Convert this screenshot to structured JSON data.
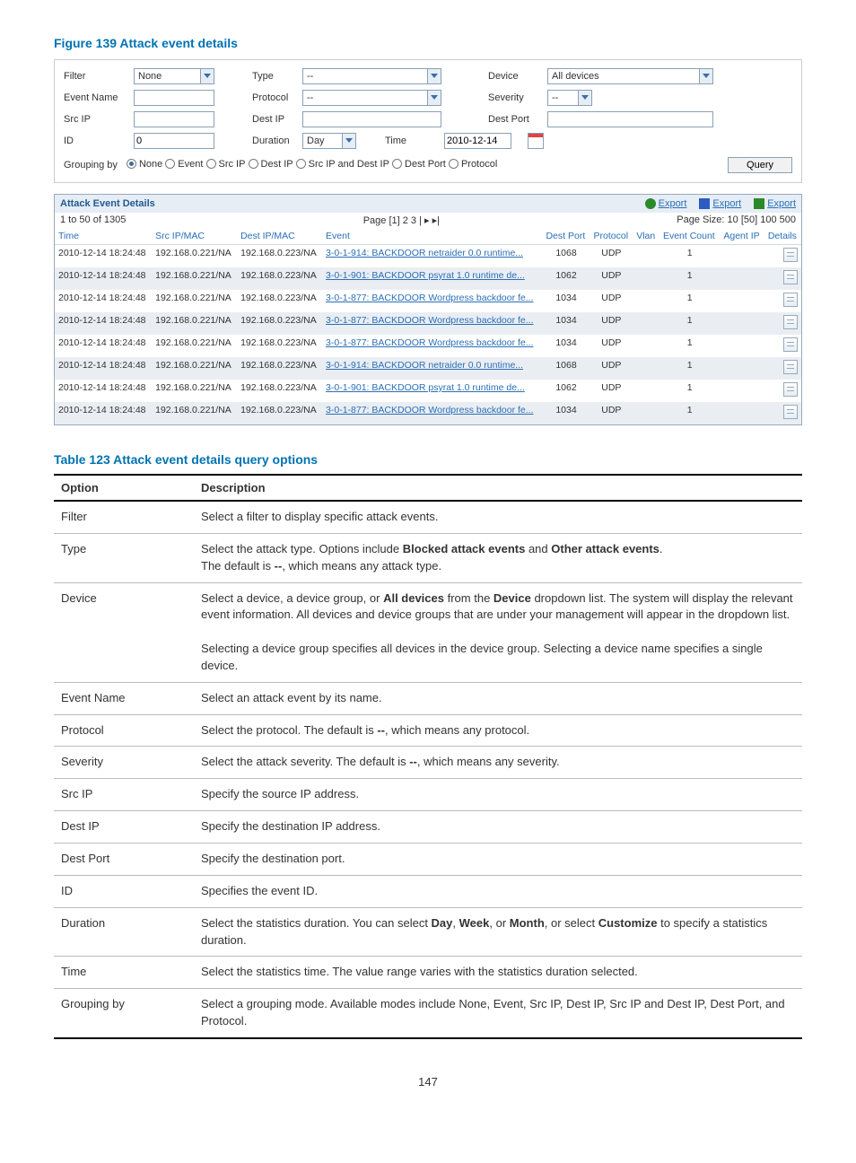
{
  "figure_title": "Figure 139 Attack event details",
  "filter": {
    "labels": {
      "filter": "Filter",
      "type": "Type",
      "device": "Device",
      "event_name": "Event Name",
      "protocol": "Protocol",
      "severity": "Severity",
      "src_ip": "Src IP",
      "dest_ip": "Dest IP",
      "dest_port": "Dest Port",
      "id": "ID",
      "duration": "Duration",
      "time": "Time"
    },
    "values": {
      "filter": "None",
      "type": "--",
      "device": "All devices",
      "event_name": "",
      "protocol": "--",
      "severity": "--",
      "src_ip": "",
      "dest_ip": "",
      "dest_port": "",
      "id": "0",
      "duration": "Day",
      "time": "2010-12-14"
    },
    "grouping_label": "Grouping by",
    "grouping_options": [
      "None",
      "Event",
      "Src IP",
      "Dest IP",
      "Src IP and Dest IP",
      "Dest Port",
      "Protocol"
    ],
    "grouping_selected": "None",
    "query_button": "Query"
  },
  "details": {
    "title": "Attack Event Details",
    "exports": [
      "Export",
      "Export",
      "Export"
    ],
    "count_text": "1 to 50 of 1305",
    "pager": "Page [1] 2 3 | ▸ ▸|",
    "page_size": "Page Size: 10 [50] 100 500",
    "columns": [
      "Time",
      "Src IP/MAC",
      "Dest IP/MAC",
      "Event",
      "Dest Port",
      "Protocol",
      "Vlan",
      "Event Count",
      "Agent IP",
      "Details"
    ],
    "rows": [
      {
        "time": "2010-12-14 18:24:48",
        "src": "192.168.0.221/NA",
        "dst": "192.168.0.223/NA",
        "event": "3-0-1-914: BACKDOOR netraider 0.0 runtime...",
        "port": "1068",
        "proto": "UDP",
        "count": "1"
      },
      {
        "time": "2010-12-14 18:24:48",
        "src": "192.168.0.221/NA",
        "dst": "192.168.0.223/NA",
        "event": "3-0-1-901: BACKDOOR psyrat 1.0 runtime de...",
        "port": "1062",
        "proto": "UDP",
        "count": "1"
      },
      {
        "time": "2010-12-14 18:24:48",
        "src": "192.168.0.221/NA",
        "dst": "192.168.0.223/NA",
        "event": "3-0-1-877: BACKDOOR Wordpress backdoor fe...",
        "port": "1034",
        "proto": "UDP",
        "count": "1"
      },
      {
        "time": "2010-12-14 18:24:48",
        "src": "192.168.0.221/NA",
        "dst": "192.168.0.223/NA",
        "event": "3-0-1-877: BACKDOOR Wordpress backdoor fe...",
        "port": "1034",
        "proto": "UDP",
        "count": "1"
      },
      {
        "time": "2010-12-14 18:24:48",
        "src": "192.168.0.221/NA",
        "dst": "192.168.0.223/NA",
        "event": "3-0-1-877: BACKDOOR Wordpress backdoor fe...",
        "port": "1034",
        "proto": "UDP",
        "count": "1"
      },
      {
        "time": "2010-12-14 18:24:48",
        "src": "192.168.0.221/NA",
        "dst": "192.168.0.223/NA",
        "event": "3-0-1-914: BACKDOOR netraider 0.0 runtime...",
        "port": "1068",
        "proto": "UDP",
        "count": "1"
      },
      {
        "time": "2010-12-14 18:24:48",
        "src": "192.168.0.221/NA",
        "dst": "192.168.0.223/NA",
        "event": "3-0-1-901: BACKDOOR psyrat 1.0 runtime de...",
        "port": "1062",
        "proto": "UDP",
        "count": "1"
      },
      {
        "time": "2010-12-14 18:24:48",
        "src": "192.168.0.221/NA",
        "dst": "192.168.0.223/NA",
        "event": "3-0-1-877: BACKDOOR Wordpress backdoor fe...",
        "port": "1034",
        "proto": "UDP",
        "count": "1"
      }
    ]
  },
  "table_caption": "Table 123 Attack event details query options",
  "options_table": {
    "headers": [
      "Option",
      "Description"
    ],
    "rows": [
      {
        "opt": "Filter",
        "desc": "Select a filter to display specific attack events."
      },
      {
        "opt": "Type",
        "desc": "Select the attack type. Options include <b>Blocked attack events</b> and <b>Other attack events</b>.<br>The default is <b>--</b>, which means any attack type."
      },
      {
        "opt": "Device",
        "desc": "Select a device, a device group, or <b>All devices</b> from the <b>Device</b> dropdown list. The system will display the relevant event information. All devices and device groups that are under your management will appear in the dropdown list.<br><br>Selecting a device group specifies all devices in the device group. Selecting a device name specifies a single device."
      },
      {
        "opt": "Event Name",
        "desc": "Select an attack event by its name."
      },
      {
        "opt": "Protocol",
        "desc": "Select the protocol. The default is <b>--</b>, which means any protocol."
      },
      {
        "opt": "Severity",
        "desc": "Select the attack severity. The default is <b>--</b>, which means any severity."
      },
      {
        "opt": "Src IP",
        "desc": "Specify the source IP address."
      },
      {
        "opt": "Dest IP",
        "desc": "Specify the destination IP address."
      },
      {
        "opt": "Dest Port",
        "desc": "Specify the destination port."
      },
      {
        "opt": "ID",
        "desc": "Specifies the event ID."
      },
      {
        "opt": "Duration",
        "desc": "Select the statistics duration. You can select <b>Day</b>, <b>Week</b>, or <b>Month</b>, or select <b>Customize</b> to specify a statistics duration."
      },
      {
        "opt": "Time",
        "desc": "Select the statistics time. The value range varies with the statistics duration selected."
      },
      {
        "opt": "Grouping by",
        "desc": "Select a grouping mode. Available modes include None, Event, Src IP, Dest IP, Src IP and Dest IP, Dest Port, and Protocol."
      }
    ]
  },
  "page_number": "147"
}
